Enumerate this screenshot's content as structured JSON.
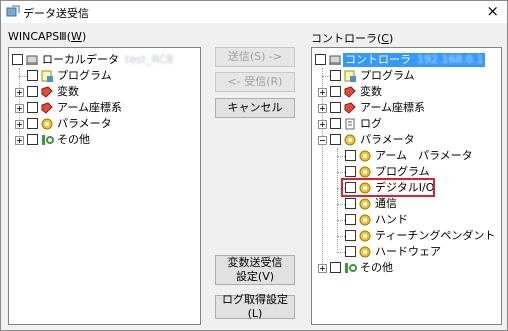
{
  "window": {
    "title": "データ送受信",
    "close_glyph": "×"
  },
  "left_panel": {
    "label": "WINCAPSⅢ(",
    "label_key": "W",
    "label_end": ")",
    "root": {
      "label": "ローカルデータ",
      "suffix": "test_RC8"
    },
    "items": [
      "プログラム",
      "変数",
      "アーム座標系",
      "パラメータ",
      "その他"
    ]
  },
  "right_panel": {
    "label": "コントローラ(",
    "label_key": "C",
    "label_end": ")",
    "root": {
      "label": "コントローラ",
      "suffix": "192.168.0.1"
    },
    "items": [
      "プログラム",
      "変数",
      "アーム座標系",
      "ログ",
      "パラメータ",
      "その他"
    ],
    "param_children": [
      "アーム　パラメータ",
      "プログラム",
      "デジタルI/O",
      "通信",
      "ハンド",
      "ティーチングペンダント",
      "ハードウェア"
    ]
  },
  "buttons": {
    "send": "送信(S) ->",
    "receive": "<- 受信(R)",
    "cancel": "キャンセル",
    "var_settings_line1": "変数送受信",
    "var_settings_line2": "設定(V)",
    "log_settings": "ログ取得設定(L)"
  },
  "colors": {
    "highlight": "#e0202a",
    "selection": "#3399ff"
  }
}
